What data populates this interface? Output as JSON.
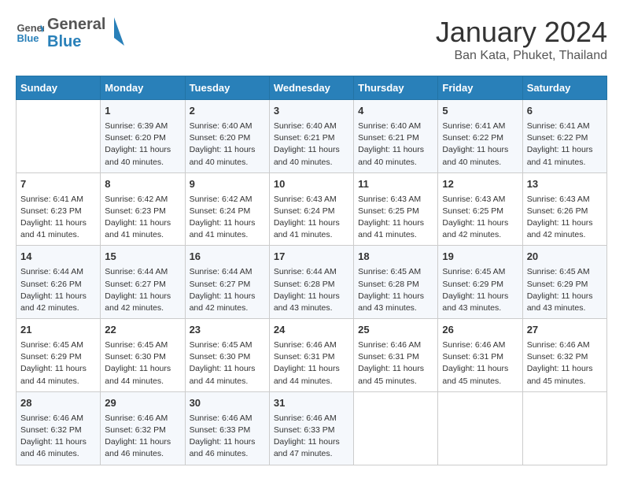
{
  "header": {
    "logo_general": "General",
    "logo_blue": "Blue",
    "month": "January 2024",
    "location": "Ban Kata, Phuket, Thailand"
  },
  "days_of_week": [
    "Sunday",
    "Monday",
    "Tuesday",
    "Wednesday",
    "Thursday",
    "Friday",
    "Saturday"
  ],
  "weeks": [
    [
      {
        "day": "",
        "info": ""
      },
      {
        "day": "1",
        "info": "Sunrise: 6:39 AM\nSunset: 6:20 PM\nDaylight: 11 hours\nand 40 minutes."
      },
      {
        "day": "2",
        "info": "Sunrise: 6:40 AM\nSunset: 6:20 PM\nDaylight: 11 hours\nand 40 minutes."
      },
      {
        "day": "3",
        "info": "Sunrise: 6:40 AM\nSunset: 6:21 PM\nDaylight: 11 hours\nand 40 minutes."
      },
      {
        "day": "4",
        "info": "Sunrise: 6:40 AM\nSunset: 6:21 PM\nDaylight: 11 hours\nand 40 minutes."
      },
      {
        "day": "5",
        "info": "Sunrise: 6:41 AM\nSunset: 6:22 PM\nDaylight: 11 hours\nand 40 minutes."
      },
      {
        "day": "6",
        "info": "Sunrise: 6:41 AM\nSunset: 6:22 PM\nDaylight: 11 hours\nand 41 minutes."
      }
    ],
    [
      {
        "day": "7",
        "info": "Sunrise: 6:41 AM\nSunset: 6:23 PM\nDaylight: 11 hours\nand 41 minutes."
      },
      {
        "day": "8",
        "info": "Sunrise: 6:42 AM\nSunset: 6:23 PM\nDaylight: 11 hours\nand 41 minutes."
      },
      {
        "day": "9",
        "info": "Sunrise: 6:42 AM\nSunset: 6:24 PM\nDaylight: 11 hours\nand 41 minutes."
      },
      {
        "day": "10",
        "info": "Sunrise: 6:43 AM\nSunset: 6:24 PM\nDaylight: 11 hours\nand 41 minutes."
      },
      {
        "day": "11",
        "info": "Sunrise: 6:43 AM\nSunset: 6:25 PM\nDaylight: 11 hours\nand 41 minutes."
      },
      {
        "day": "12",
        "info": "Sunrise: 6:43 AM\nSunset: 6:25 PM\nDaylight: 11 hours\nand 42 minutes."
      },
      {
        "day": "13",
        "info": "Sunrise: 6:43 AM\nSunset: 6:26 PM\nDaylight: 11 hours\nand 42 minutes."
      }
    ],
    [
      {
        "day": "14",
        "info": "Sunrise: 6:44 AM\nSunset: 6:26 PM\nDaylight: 11 hours\nand 42 minutes."
      },
      {
        "day": "15",
        "info": "Sunrise: 6:44 AM\nSunset: 6:27 PM\nDaylight: 11 hours\nand 42 minutes."
      },
      {
        "day": "16",
        "info": "Sunrise: 6:44 AM\nSunset: 6:27 PM\nDaylight: 11 hours\nand 42 minutes."
      },
      {
        "day": "17",
        "info": "Sunrise: 6:44 AM\nSunset: 6:28 PM\nDaylight: 11 hours\nand 43 minutes."
      },
      {
        "day": "18",
        "info": "Sunrise: 6:45 AM\nSunset: 6:28 PM\nDaylight: 11 hours\nand 43 minutes."
      },
      {
        "day": "19",
        "info": "Sunrise: 6:45 AM\nSunset: 6:29 PM\nDaylight: 11 hours\nand 43 minutes."
      },
      {
        "day": "20",
        "info": "Sunrise: 6:45 AM\nSunset: 6:29 PM\nDaylight: 11 hours\nand 43 minutes."
      }
    ],
    [
      {
        "day": "21",
        "info": "Sunrise: 6:45 AM\nSunset: 6:29 PM\nDaylight: 11 hours\nand 44 minutes."
      },
      {
        "day": "22",
        "info": "Sunrise: 6:45 AM\nSunset: 6:30 PM\nDaylight: 11 hours\nand 44 minutes."
      },
      {
        "day": "23",
        "info": "Sunrise: 6:45 AM\nSunset: 6:30 PM\nDaylight: 11 hours\nand 44 minutes."
      },
      {
        "day": "24",
        "info": "Sunrise: 6:46 AM\nSunset: 6:31 PM\nDaylight: 11 hours\nand 44 minutes."
      },
      {
        "day": "25",
        "info": "Sunrise: 6:46 AM\nSunset: 6:31 PM\nDaylight: 11 hours\nand 45 minutes."
      },
      {
        "day": "26",
        "info": "Sunrise: 6:46 AM\nSunset: 6:31 PM\nDaylight: 11 hours\nand 45 minutes."
      },
      {
        "day": "27",
        "info": "Sunrise: 6:46 AM\nSunset: 6:32 PM\nDaylight: 11 hours\nand 45 minutes."
      }
    ],
    [
      {
        "day": "28",
        "info": "Sunrise: 6:46 AM\nSunset: 6:32 PM\nDaylight: 11 hours\nand 46 minutes."
      },
      {
        "day": "29",
        "info": "Sunrise: 6:46 AM\nSunset: 6:32 PM\nDaylight: 11 hours\nand 46 minutes."
      },
      {
        "day": "30",
        "info": "Sunrise: 6:46 AM\nSunset: 6:33 PM\nDaylight: 11 hours\nand 46 minutes."
      },
      {
        "day": "31",
        "info": "Sunrise: 6:46 AM\nSunset: 6:33 PM\nDaylight: 11 hours\nand 47 minutes."
      },
      {
        "day": "",
        "info": ""
      },
      {
        "day": "",
        "info": ""
      },
      {
        "day": "",
        "info": ""
      }
    ]
  ]
}
